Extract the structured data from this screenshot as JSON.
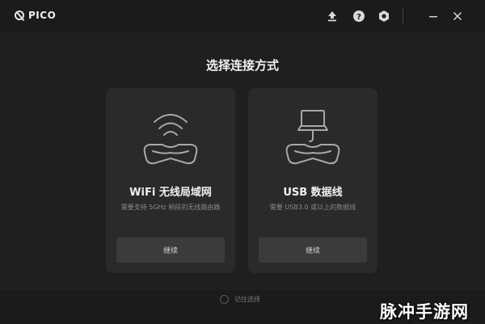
{
  "app": {
    "logo_text": "PICO"
  },
  "titlebar": {
    "icons": [
      "upload-icon",
      "help-icon",
      "settings-icon",
      "minimize-icon",
      "close-icon"
    ]
  },
  "main": {
    "heading": "选择连接方式",
    "cards": [
      {
        "id": "wifi",
        "title": "WiFi 无线局域网",
        "description": "需要支持 5GHz 频段的无线路由器",
        "button_label": "继续"
      },
      {
        "id": "usb",
        "title": "USB 数据线",
        "description": "需要 USB3.0 或以上的数据线",
        "button_label": "继续"
      }
    ]
  },
  "footer": {
    "remember_label": "记住选择",
    "remember_checked": false
  },
  "watermark": "脉冲手游网",
  "colors": {
    "background": "#1f1f1f",
    "card": "#2a2a2a",
    "button": "#3b3b3b",
    "titlebar": "#1b1b1b"
  }
}
